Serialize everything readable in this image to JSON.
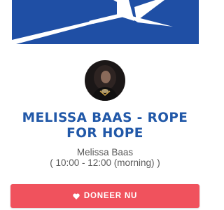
{
  "banner": {
    "icon": "star-banner",
    "color": "#1f4fa5"
  },
  "event": {
    "title": "MELISSA BAAS - ROPE FOR HOPE",
    "organizer": "Melissa Baas",
    "time": "( 10:00 - 12:00 (morning) )"
  },
  "donate": {
    "label": "DONEER NU",
    "icon": "heart-icon",
    "color": "#f0525d"
  }
}
